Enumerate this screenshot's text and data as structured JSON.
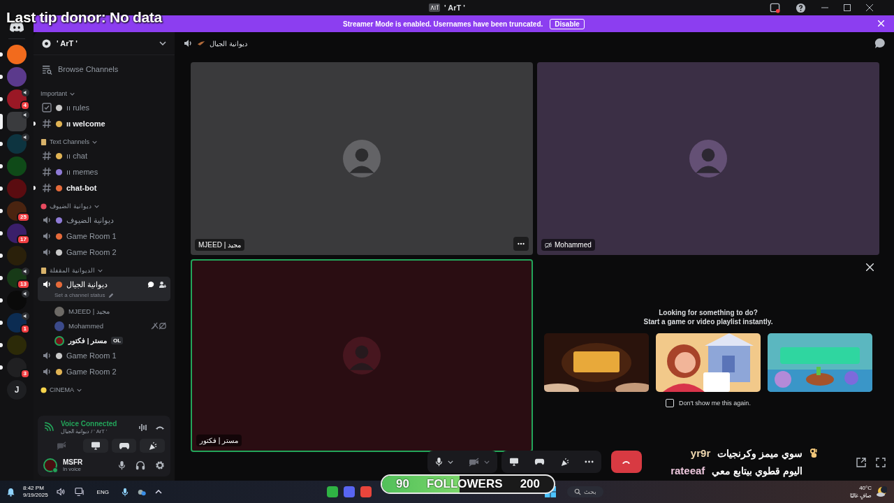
{
  "overlay_donor": "Last tip donor: No data",
  "window": {
    "title": "' ArT '"
  },
  "banner": {
    "message": "Streamer Mode is enabled. Usernames have been truncated.",
    "button": "Disable"
  },
  "servers": [
    {
      "color": "#f26b1d",
      "unread": true,
      "selected": false,
      "voice": false
    },
    {
      "color": "#5b3a8c",
      "unread": true,
      "selected": false,
      "voice": false
    },
    {
      "color": "#9a1825",
      "unread": true,
      "selected": false,
      "voice": true,
      "badge": "4"
    },
    {
      "color": "#3a3b3e",
      "unread": false,
      "selected": true,
      "voice": true
    },
    {
      "color": "#0d3440",
      "unread": true,
      "selected": false,
      "voice": true
    },
    {
      "color": "#0f4a18",
      "unread": true,
      "selected": false,
      "voice": false
    },
    {
      "color": "#5a0c10",
      "unread": true,
      "selected": false,
      "voice": false
    },
    {
      "color": "#4a2410",
      "unread": true,
      "selected": false,
      "voice": false,
      "badge": "25"
    },
    {
      "color": "#3a1f6a",
      "unread": true,
      "selected": false,
      "voice": false,
      "badge": "17"
    },
    {
      "color": "#2a200a",
      "unread": true,
      "selected": false,
      "voice": false
    },
    {
      "color": "#173a17",
      "unread": true,
      "selected": false,
      "voice": true,
      "badge": "13"
    },
    {
      "color": "#0a0a0a",
      "unread": true,
      "selected": false,
      "voice": true
    },
    {
      "color": "#0c2c52",
      "unread": true,
      "selected": false,
      "voice": true,
      "badge": "1"
    },
    {
      "color": "#2c2a08",
      "unread": true,
      "selected": false,
      "voice": false
    },
    {
      "color": "#202022",
      "unread": true,
      "selected": false,
      "voice": false,
      "badge": "3"
    },
    {
      "color": "#1e1f22",
      "unread": false,
      "selected": false,
      "voice": false,
      "letter": "J"
    }
  ],
  "sidebar": {
    "server_name": "' ArT '",
    "browse": "Browse Channels",
    "categories": [
      {
        "name": "Important",
        "channels": [
          {
            "kind": "rules",
            "name": "ıı rules",
            "unread": false,
            "selected": false
          },
          {
            "kind": "text",
            "name": "ıı welcome",
            "unread": true,
            "selected": false
          }
        ]
      },
      {
        "name": "Text Channels",
        "channels": [
          {
            "kind": "text",
            "name": "ıı chat",
            "unread": false,
            "selected": false
          },
          {
            "kind": "text",
            "name": "ıı memes",
            "unread": false,
            "selected": false
          },
          {
            "kind": "text",
            "name": "chat-bot",
            "unread": true,
            "selected": false
          }
        ]
      },
      {
        "name": "ديوانية الضيوف",
        "channels": [
          {
            "kind": "voice",
            "name": "ديوانية الضيوف",
            "unread": false,
            "selected": false
          },
          {
            "kind": "voice",
            "name": "Game Room 1",
            "unread": false,
            "selected": false
          },
          {
            "kind": "voice",
            "name": "Game Room 2",
            "unread": false,
            "selected": false
          }
        ]
      },
      {
        "name": "الديوانية المقفلة",
        "channels": [
          {
            "kind": "voice",
            "name": "ديوانية الجيال",
            "unread": false,
            "selected": true,
            "status": "Set a channel status",
            "members": [
              {
                "name": "MJEED | مجيد",
                "speaking": false,
                "muted": false,
                "color": "#6d6a66"
              },
              {
                "name": "Mohammed",
                "speaking": false,
                "muted": true,
                "color": "#3b4a8a"
              },
              {
                "name": "مستر | فكتور",
                "speaking": true,
                "muted": false,
                "color": "#7a1218",
                "tag": "OL"
              }
            ]
          },
          {
            "kind": "voice",
            "name": "Game Room 1",
            "unread": false,
            "selected": false
          },
          {
            "kind": "voice",
            "name": "Game Room 2",
            "unread": false,
            "selected": false
          }
        ]
      },
      {
        "name": "CINEMA"
      }
    ]
  },
  "voice_panel": {
    "status": "Voice Connected",
    "channel": "ديوانية الجيال / ' ArT '"
  },
  "user_panel": {
    "name": "MSFR",
    "status": "In voice"
  },
  "main": {
    "channel": "ديوانية الجيال",
    "tiles": [
      {
        "kind": "user",
        "name": "MJEED | مجيد",
        "speaking": false,
        "camera_off": false,
        "menu": true,
        "color": "#3a3a3c"
      },
      {
        "kind": "user",
        "name": "Mohammed",
        "speaking": false,
        "camera_off": true,
        "menu": false,
        "color": "#3b2f45"
      },
      {
        "kind": "user",
        "name": "مستر | فكتور",
        "speaking": true,
        "camera_off": false,
        "menu": false,
        "color": "#2a0d12"
      },
      {
        "kind": "activity",
        "title": "Looking for something to do?",
        "subtitle": "Start a game or video playlist instantly.",
        "checkbox": {
          "label": "Don't show me this again.",
          "checked": false
        }
      }
    ],
    "controls": [
      {
        "kind": "mic",
        "on": true
      },
      {
        "kind": "camera",
        "on": false
      },
      {
        "kind": "share"
      },
      {
        "kind": "activity"
      },
      {
        "kind": "soundboard"
      },
      {
        "kind": "more"
      },
      {
        "kind": "hangup"
      }
    ]
  },
  "chat_overlay": [
    {
      "user": "yr9r",
      "text": "سوي ميمز وكرنجيات",
      "hand": true,
      "color": "#f0d9b0"
    },
    {
      "user": "rateeaf",
      "text": "اليوم قطوي بيتابع معي",
      "hand": false,
      "color": "#ecc6dc"
    }
  ],
  "followers": {
    "current": "90",
    "label": "FOLLOWERS",
    "goal": "200",
    "level": 0.45
  },
  "taskbar": {
    "time": "8:42 PM",
    "date": "9/19/2025",
    "language": "ENG",
    "search": "بحث",
    "apps": [
      {
        "color": "#2fb344"
      },
      {
        "color": "#5865f2"
      },
      {
        "color": "#e8453c"
      }
    ],
    "weather": {
      "temperature": "40°C",
      "condition": "صافٍ غالبًا"
    }
  }
}
